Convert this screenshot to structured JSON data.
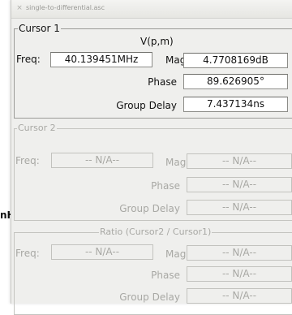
{
  "window": {
    "title": "single-to-differential.asc",
    "close_glyph": "×",
    "background_fragment": "nH"
  },
  "cursor1": {
    "title": "Cursor 1",
    "header": "V(p,m)",
    "freq_label": "Freq:",
    "freq_value": "40.139451MHz",
    "mag_label": "Mag:",
    "mag_value": "4.7708169dB",
    "phase_label": "Phase",
    "phase_value": "89.626905°",
    "group_delay_label": "Group Delay",
    "group_delay_value": "7.437134ns"
  },
  "cursor2": {
    "title": "Cursor 2",
    "freq_label": "Freq:",
    "freq_value": "-- N/A--",
    "mag_label": "Mag:",
    "mag_value": "-- N/A--",
    "phase_label": "Phase",
    "phase_value": "-- N/A--",
    "group_delay_label": "Group Delay",
    "group_delay_value": "-- N/A--"
  },
  "ratio": {
    "title": "Ratio (Cursor2 / Cursor1)",
    "freq_label": "Freq:",
    "freq_value": "-- N/A--",
    "mag_label": "Mag:",
    "mag_value": "-- N/A--",
    "phase_label": "Phase",
    "phase_value": "-- N/A--",
    "group_delay_label": "Group Delay",
    "group_delay_value": "-- N/A--"
  }
}
